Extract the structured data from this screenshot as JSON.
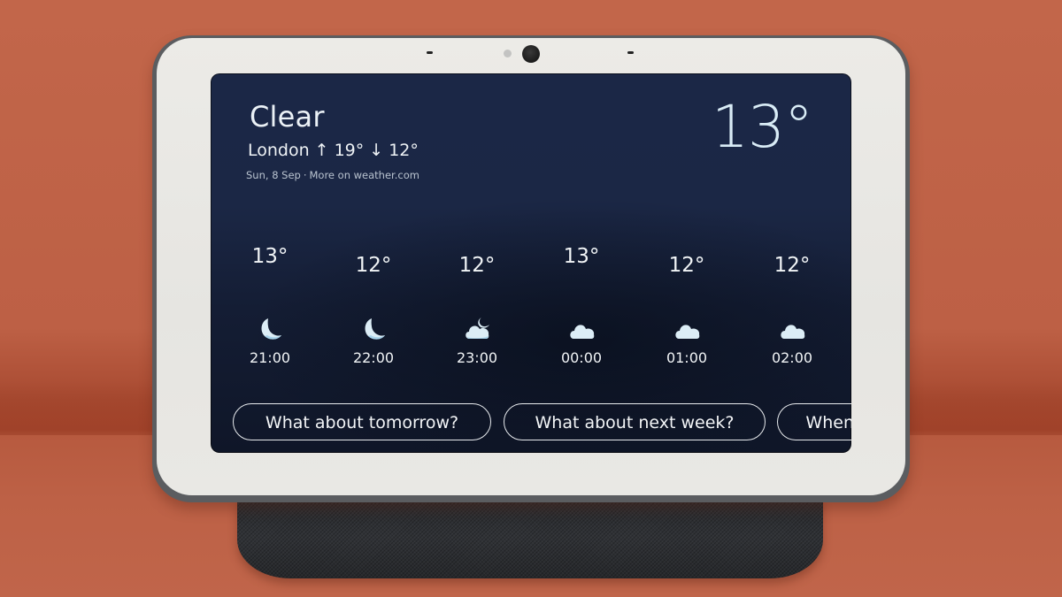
{
  "weather": {
    "condition": "Clear",
    "location": "London",
    "high_arrow": "↑",
    "high": "19°",
    "low_arrow": "↓",
    "low": "12°",
    "date": "Sun, 8 Sep",
    "separator": "·",
    "more_link": "More on weather.com",
    "current_temp": "13°"
  },
  "hourly": [
    {
      "temp": "13°",
      "time": "21:00",
      "icon": "moon-clear-icon"
    },
    {
      "temp": "12°",
      "time": "22:00",
      "icon": "moon-clear-icon"
    },
    {
      "temp": "12°",
      "time": "23:00",
      "icon": "cloud-moon-icon"
    },
    {
      "temp": "13°",
      "time": "00:00",
      "icon": "cloud-icon"
    },
    {
      "temp": "12°",
      "time": "01:00",
      "icon": "cloud-icon"
    },
    {
      "temp": "12°",
      "time": "02:00",
      "icon": "cloud-icon"
    }
  ],
  "suggestions": [
    "What about tomorrow?",
    "What about next week?",
    "When w"
  ],
  "colors": {
    "screen_bg": "#1b2746",
    "icon_fill": "#dcedf6",
    "background": "#c2664a"
  }
}
